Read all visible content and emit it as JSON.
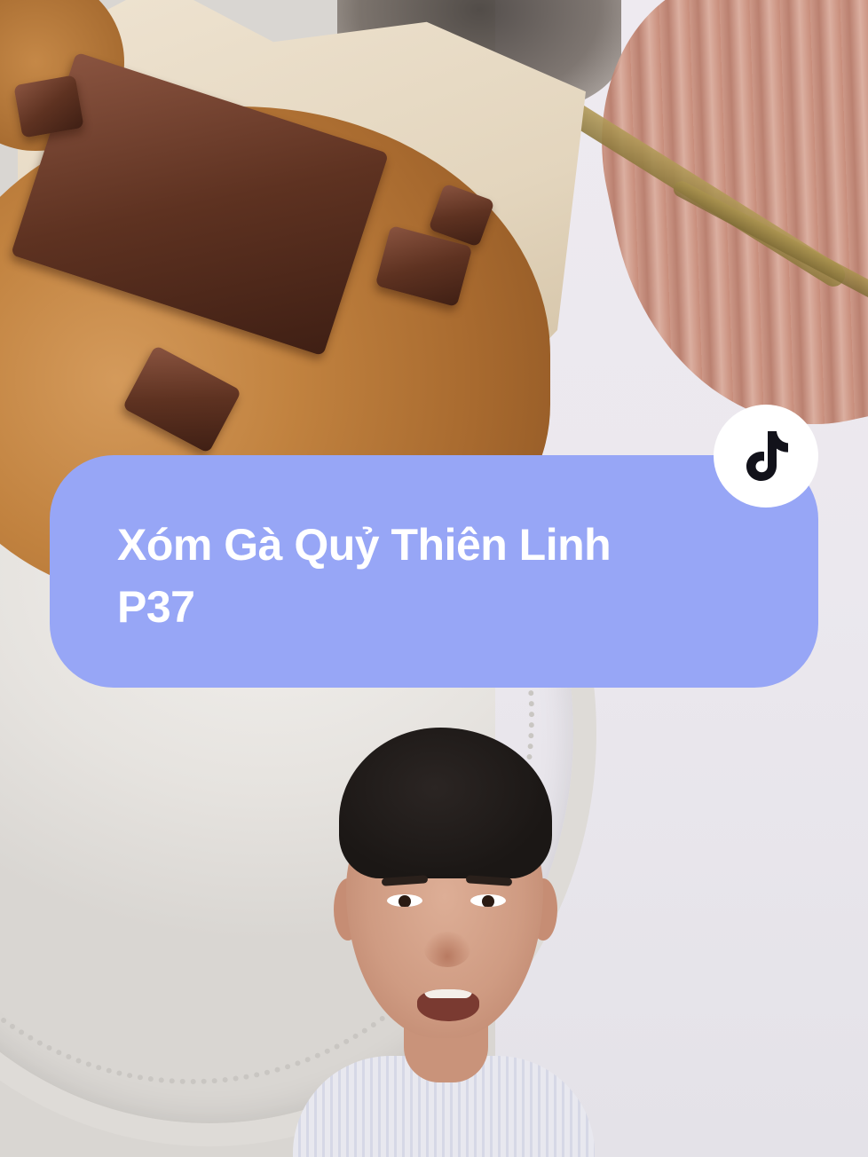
{
  "video": {
    "title_line_1": "Xóm Gà Quỷ Thiên Linh",
    "title_line_2": "P37",
    "card_color": "#97a6f6"
  },
  "brand": {
    "icon": "tiktok-logo-icon"
  }
}
